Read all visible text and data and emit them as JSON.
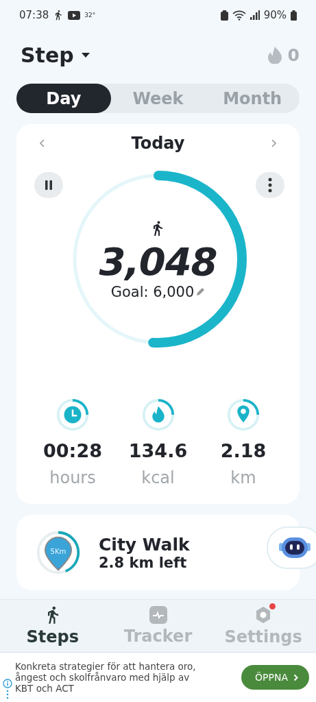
{
  "status_bar": {
    "time": "07:38",
    "temperature": "32°",
    "battery": "90%"
  },
  "header": {
    "title": "Step",
    "streak": "0"
  },
  "tabs": [
    {
      "label": "Day",
      "selected": true
    },
    {
      "label": "Week",
      "selected": false
    },
    {
      "label": "Month",
      "selected": false
    }
  ],
  "day_card": {
    "title": "Today",
    "steps": "3,048",
    "goal": "Goal: 6,000",
    "level": 0.51,
    "stats": [
      {
        "kind": "time",
        "value": "00:28",
        "unit": "hours"
      },
      {
        "kind": "calories",
        "value": "134.6",
        "unit": "kcal"
      },
      {
        "kind": "distance",
        "value": "2.18",
        "unit": "km"
      }
    ]
  },
  "challenge": {
    "badge": "5Km",
    "title": "City Walk",
    "remaining": "2.8 km left",
    "level": 0.44
  },
  "bottom_nav": [
    {
      "label": "Steps",
      "kind": "steps",
      "selected": true,
      "badge": false
    },
    {
      "label": "Tracker",
      "kind": "tracker",
      "selected": false,
      "badge": false
    },
    {
      "label": "Settings",
      "kind": "settings",
      "selected": false,
      "badge": true
    }
  ],
  "ad": {
    "text": "Konkreta strategier för att hantera oro, ångest och skolfrånvaro med hjälp av KBT och ACT",
    "button": "ÖPPNA"
  }
}
